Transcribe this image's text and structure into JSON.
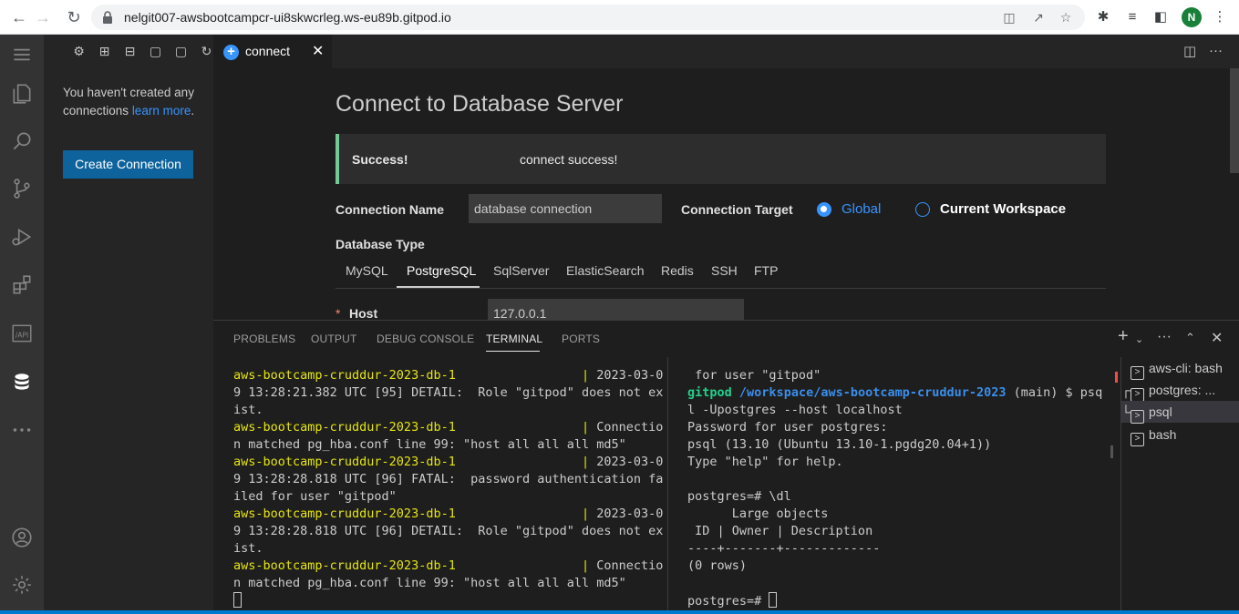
{
  "browser": {
    "url": "nelgit007-awsbootcampcr-ui8skwcrleg.ws-eu89b.gitpod.io",
    "profile_initial": "N",
    "profile_color": "#188038"
  },
  "sidebar": {
    "message_prefix": "You haven't created any connections ",
    "message_link": "learn more",
    "message_suffix": ".",
    "create_button": "Create Connection"
  },
  "editor": {
    "tab_label": "connect",
    "page_title": "Connect to Database Server",
    "alert": {
      "title": "Success!",
      "message": "connect success!"
    },
    "connection_name_label": "Connection Name",
    "connection_name_value": "database connection",
    "connection_target_label": "Connection Target",
    "target_options": [
      {
        "label": "Global",
        "checked": true
      },
      {
        "label": "Current Workspace",
        "checked": false
      }
    ],
    "database_type_label": "Database Type",
    "db_types": [
      "MySQL",
      "PostgreSQL",
      "SqlServer",
      "ElasticSearch",
      "Redis",
      "SSH",
      "FTP"
    ],
    "db_type_selected": "PostgreSQL",
    "host_label": "Host",
    "host_value": "127.0.0.1"
  },
  "panel": {
    "tabs": [
      "PROBLEMS",
      "OUTPUT",
      "DEBUG CONSOLE",
      "TERMINAL",
      "PORTS"
    ],
    "active_tab": "TERMINAL",
    "left_terminal": [
      [
        {
          "t": "aws-bootcamp-cruddur-2023-db-1",
          "c": "yellow"
        },
        {
          "t": "                 ",
          "c": ""
        },
        {
          "t": "|",
          "c": "yellow"
        },
        {
          "t": " 2023-03-0",
          "c": ""
        }
      ],
      [
        {
          "t": "9 13:28:21.382 UTC [95] DETAIL:  Role \"gitpod\" does not ex",
          "c": ""
        }
      ],
      [
        {
          "t": "ist.",
          "c": ""
        }
      ],
      [
        {
          "t": "aws-bootcamp-cruddur-2023-db-1",
          "c": "yellow"
        },
        {
          "t": "                 ",
          "c": ""
        },
        {
          "t": "|",
          "c": "yellow"
        },
        {
          "t": " Connectio",
          "c": ""
        }
      ],
      [
        {
          "t": "n matched pg_hba.conf line 99: \"host all all all md5\"",
          "c": ""
        }
      ],
      [
        {
          "t": "aws-bootcamp-cruddur-2023-db-1",
          "c": "yellow"
        },
        {
          "t": "                 ",
          "c": ""
        },
        {
          "t": "|",
          "c": "yellow"
        },
        {
          "t": " 2023-03-0",
          "c": ""
        }
      ],
      [
        {
          "t": "9 13:28:28.818 UTC [96] FATAL:  password authentication fa",
          "c": ""
        }
      ],
      [
        {
          "t": "iled for user \"gitpod\"",
          "c": ""
        }
      ],
      [
        {
          "t": "aws-bootcamp-cruddur-2023-db-1",
          "c": "yellow"
        },
        {
          "t": "                 ",
          "c": ""
        },
        {
          "t": "|",
          "c": "yellow"
        },
        {
          "t": " 2023-03-0",
          "c": ""
        }
      ],
      [
        {
          "t": "9 13:28:28.818 UTC [96] DETAIL:  Role \"gitpod\" does not ex",
          "c": ""
        }
      ],
      [
        {
          "t": "ist.",
          "c": ""
        }
      ],
      [
        {
          "t": "aws-bootcamp-cruddur-2023-db-1",
          "c": "yellow"
        },
        {
          "t": "                 ",
          "c": ""
        },
        {
          "t": "|",
          "c": "yellow"
        },
        {
          "t": " Connectio",
          "c": ""
        }
      ],
      [
        {
          "t": "n matched pg_hba.conf line 99: \"host all all all md5\"",
          "c": ""
        }
      ]
    ],
    "right_terminal": [
      [
        {
          "t": " for user \"gitpod\"",
          "c": ""
        }
      ],
      [
        {
          "t": "gitpod",
          "c": "green"
        },
        {
          "t": " ",
          "c": ""
        },
        {
          "t": "/workspace/aws-bootcamp-cruddur-2023",
          "c": "blue"
        },
        {
          "t": " (main) $ psq",
          "c": ""
        }
      ],
      [
        {
          "t": "l -Upostgres --host localhost",
          "c": ""
        }
      ],
      [
        {
          "t": "Password for user postgres:",
          "c": ""
        }
      ],
      [
        {
          "t": "psql (13.10 (Ubuntu 13.10-1.pgdg20.04+1))",
          "c": ""
        }
      ],
      [
        {
          "t": "Type \"help\" for help.",
          "c": ""
        }
      ],
      [
        {
          "t": "",
          "c": ""
        }
      ],
      [
        {
          "t": "postgres=# \\dl",
          "c": ""
        }
      ],
      [
        {
          "t": "      Large objects",
          "c": ""
        }
      ],
      [
        {
          "t": " ID | Owner | Description",
          "c": ""
        }
      ],
      [
        {
          "t": "----+-------+-------------",
          "c": ""
        }
      ],
      [
        {
          "t": "(0 rows)",
          "c": ""
        }
      ],
      [
        {
          "t": "",
          "c": ""
        }
      ],
      [
        {
          "t": "postgres=# ",
          "c": ""
        }
      ]
    ],
    "terminal_list": [
      {
        "label": "aws-cli: bash",
        "prefix": ""
      },
      {
        "label": "postgres: ...",
        "prefix": "┌"
      },
      {
        "label": "psql",
        "prefix": "└"
      },
      {
        "label": "bash",
        "prefix": ""
      }
    ],
    "selected_terminal": "psql"
  },
  "colors": {
    "accent": "#007acc",
    "button": "#0e639c",
    "success": "#73c991",
    "link": "#3794ff"
  }
}
